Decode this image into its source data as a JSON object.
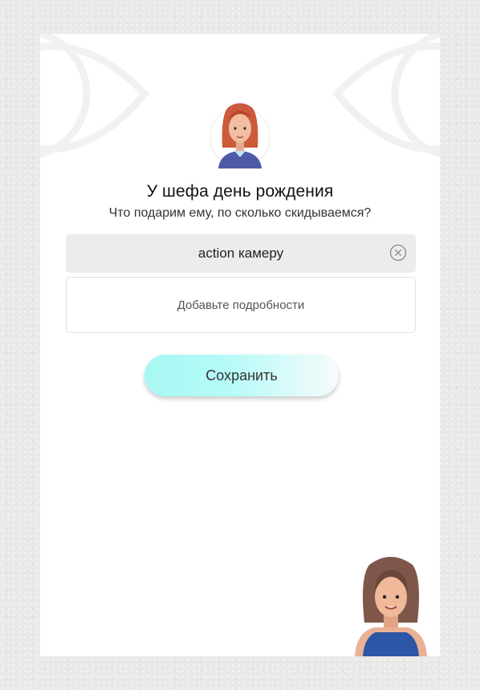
{
  "header": {
    "title": "У шефа день рождения",
    "subtitle": "Что подарим ему, по сколько скидываемся?"
  },
  "gift_input": {
    "value": "action камеру",
    "clear_icon": "clear-circle-icon"
  },
  "details_input": {
    "placeholder": "Добавьте подробности"
  },
  "actions": {
    "save_label": "Сохранить"
  },
  "colors": {
    "card_background": "#ffffff",
    "input_background": "#ececec",
    "button_gradient_start": "#a7f7f3",
    "button_gradient_end": "#f6fbfb",
    "avatar_hair": "#cd5a3c",
    "avatar_shirt": "#4e5aa6"
  }
}
